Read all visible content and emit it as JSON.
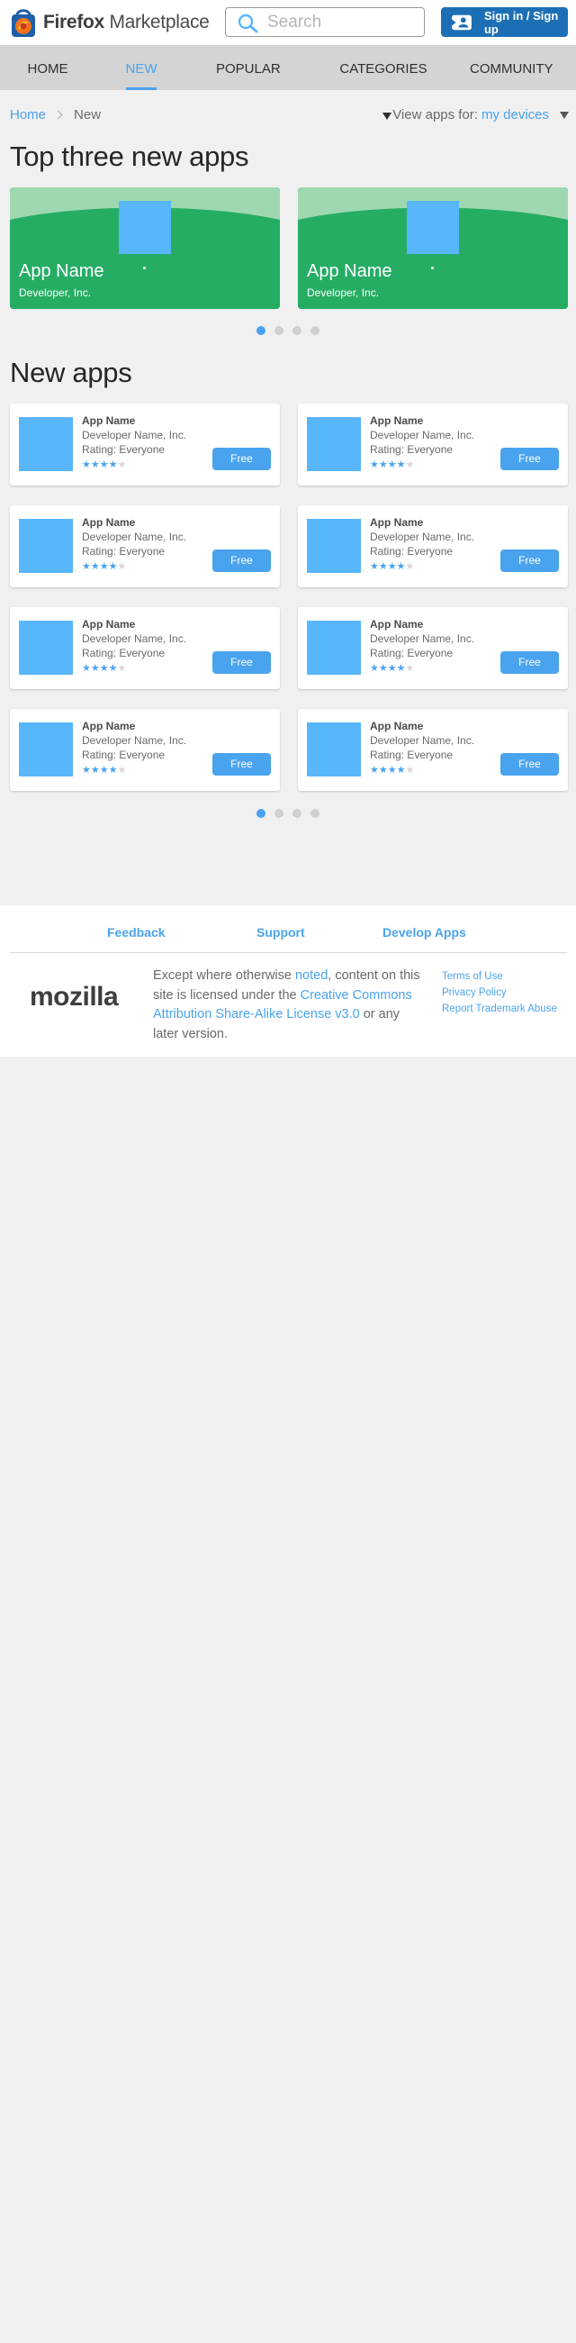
{
  "header": {
    "brand_bold": "Firefox",
    "brand_rest": " Marketplace",
    "search_placeholder": "Search",
    "signin_label": "Sign in / Sign up"
  },
  "nav": {
    "items": [
      {
        "label": "Home",
        "active": false
      },
      {
        "label": "New",
        "active": true
      },
      {
        "label": "Popular",
        "active": false
      },
      {
        "label": "Categories",
        "active": false
      },
      {
        "label": "Community",
        "active": false
      }
    ]
  },
  "breadcrumb": {
    "home": "Home",
    "current": "New"
  },
  "view_for": {
    "label": "View apps for:",
    "value": "my devices"
  },
  "featured": {
    "heading": "Top three new apps",
    "cards": [
      {
        "name": "App Name",
        "developer": "Developer, Inc."
      },
      {
        "name": "App Name",
        "developer": "Developer, Inc."
      }
    ],
    "pager": {
      "pages": 4,
      "current": 1
    }
  },
  "new_apps": {
    "heading": "New apps",
    "apps": [
      {
        "name": "App Name",
        "developer": "Developer Name, Inc.",
        "rating": "Rating: Everyone",
        "stars": 4,
        "price": "Free"
      },
      {
        "name": "App Name",
        "developer": "Developer Name, Inc.",
        "rating": "Rating: Everyone",
        "stars": 4,
        "price": "Free"
      },
      {
        "name": "App Name",
        "developer": "Developer Name, Inc.",
        "rating": "Rating: Everyone",
        "stars": 4,
        "price": "Free"
      },
      {
        "name": "App Name",
        "developer": "Developer Name, Inc.",
        "rating": "Rating: Everyone",
        "stars": 4,
        "price": "Free"
      },
      {
        "name": "App Name",
        "developer": "Developer Name, Inc.",
        "rating": "Rating: Everyone",
        "stars": 4,
        "price": "Free"
      },
      {
        "name": "App Name",
        "developer": "Developer Name, Inc.",
        "rating": "Rating: Everyone",
        "stars": 4,
        "price": "Free"
      },
      {
        "name": "App Name",
        "developer": "Developer Name, Inc.",
        "rating": "Rating: Everyone",
        "stars": 4,
        "price": "Free"
      },
      {
        "name": "App Name",
        "developer": "Developer Name, Inc.",
        "rating": "Rating: Everyone",
        "stars": 4,
        "price": "Free"
      }
    ],
    "pager": {
      "pages": 4,
      "current": 1
    }
  },
  "footer": {
    "links": [
      "Feedback",
      "Support",
      "Develop Apps"
    ],
    "logo_text": "mozilla",
    "license": {
      "t1": "Except where otherwise ",
      "l1": "noted",
      "t2": ", content on this site is licensed under the ",
      "l2": "Creative Commons Attribution Share-Alike License v3.0",
      "t3": " or any later version."
    },
    "legal_links": [
      "Terms of Use",
      "Privacy Policy",
      "Report Trademark Abuse"
    ]
  },
  "colors": {
    "accent": "#4aa3ee",
    "signin": "#1d6fb5",
    "feature_green": "#25ad64",
    "feature_light": "#9ed8b1",
    "app_icon": "#58b6fd",
    "nav_bg": "#d4d4d4",
    "page_bg": "#f0f0f0"
  },
  "icons": {
    "logo": "firefox-marketplace-bag-icon",
    "search": "search-icon",
    "signin": "persona-user-icon",
    "breadcrumb_sep": "chevron-right-icon",
    "dropdown": "caret-down-icon",
    "star": "star-icon"
  }
}
